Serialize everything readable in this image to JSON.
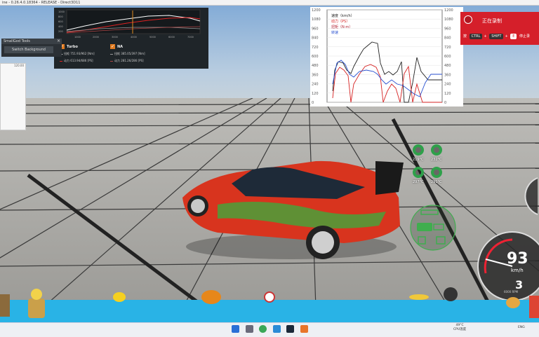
{
  "window": {
    "title": "ine - 0.26.4.0.18364 - RELEASE - Direct3D11"
  },
  "dyno": {
    "x_ticks": [
      "1000",
      "2000",
      "3000",
      "4000",
      "5000",
      "6000",
      "7000"
    ],
    "y_ticks": [
      "1000",
      "800",
      "600",
      "400",
      "200"
    ],
    "turbo": {
      "label": "Turbo",
      "torque": "扭矩 751.93/962 [Nm]",
      "power": "动力 613.94/686 [PS]"
    },
    "na": {
      "label": "NA",
      "torque": "扭矩 385.05/397 [Nm]",
      "power": "动力 281.26/286 [PS]"
    },
    "check_mark": "✓"
  },
  "small_gui": {
    "title": "SmallGod Tools",
    "button": "Switch Background",
    "close": "×"
  },
  "side_panel": {
    "label": "120.00"
  },
  "telemetry": {
    "legend": [
      "速度（km/h）",
      "动力（PS）",
      "扭矩（N·m）",
      "转速"
    ],
    "y_ticks_left": [
      "1200",
      "1080",
      "960",
      "840",
      "720",
      "600",
      "480",
      "360",
      "240",
      "120",
      "0"
    ],
    "y_ticks_right": [
      "1200",
      "1080",
      "960",
      "840",
      "720",
      "600",
      "480",
      "360",
      "240",
      "120",
      "0"
    ],
    "colors": {
      "speed": "#222222",
      "power": "#d62020",
      "torque": "#b02030",
      "rpm": "#2850d0"
    }
  },
  "recording": {
    "title": "正在录制",
    "prefix": "按",
    "key1": "CTRL",
    "plus": "+",
    "key2": "SHIFT",
    "key3": "E",
    "suffix": "停止录"
  },
  "tires": {
    "fl": "219°C",
    "fr": "232°C",
    "rl": "297°C",
    "rr": "291°C"
  },
  "speedometer": {
    "speed": "93",
    "unit": "km/h",
    "gear": "3",
    "rpm": "6000 RPM"
  },
  "taskbar": {
    "weather_temp": "49°C",
    "weather_desc": "CPU温度",
    "lang": "ENG"
  }
}
